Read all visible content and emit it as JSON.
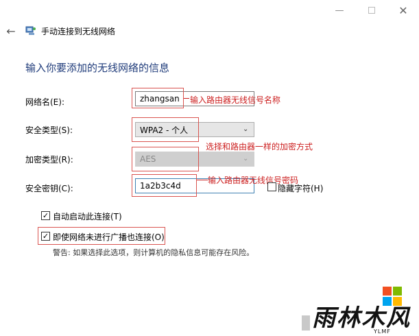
{
  "window": {
    "title": "手动连接到无线网络",
    "minimize_icon": "minimize-icon",
    "maximize_icon": "maximize-icon",
    "close_icon": "close-icon",
    "back_icon": "back-arrow-icon"
  },
  "heading": "输入你要添加的无线网络的信息",
  "form": {
    "network_name_label": "网络名(E):",
    "network_name_value": "zhangsan",
    "security_type_label": "安全类型(S):",
    "security_type_value": "WPA2 - 个人",
    "encryption_type_label": "加密类型(R):",
    "encryption_type_value": "AES",
    "security_key_label": "安全密钥(C):",
    "security_key_value": "1a2b3c4d",
    "hide_chars_label": "隐藏字符(H)",
    "hide_chars_checked": false
  },
  "options": {
    "auto_connect_label": "自动启动此连接(T)",
    "auto_connect_checked": true,
    "connect_hidden_label": "即使网络未进行广播也连接(O)",
    "connect_hidden_checked": true,
    "warning": "警告: 如果选择此选项，则计算机的隐私信息可能存在风险。"
  },
  "annotations": {
    "name_note": "输入路由器无线信号名称",
    "security_note": "选择和路由器一样的加密方式",
    "key_note": "输入路由器无线信号密码"
  },
  "watermark": {
    "brand": "雨林木风",
    "sub": "YLMF"
  },
  "colors": {
    "heading": "#1f3b7a",
    "annotation": "#cc1f1f",
    "key_border": "#3c7fb1"
  }
}
